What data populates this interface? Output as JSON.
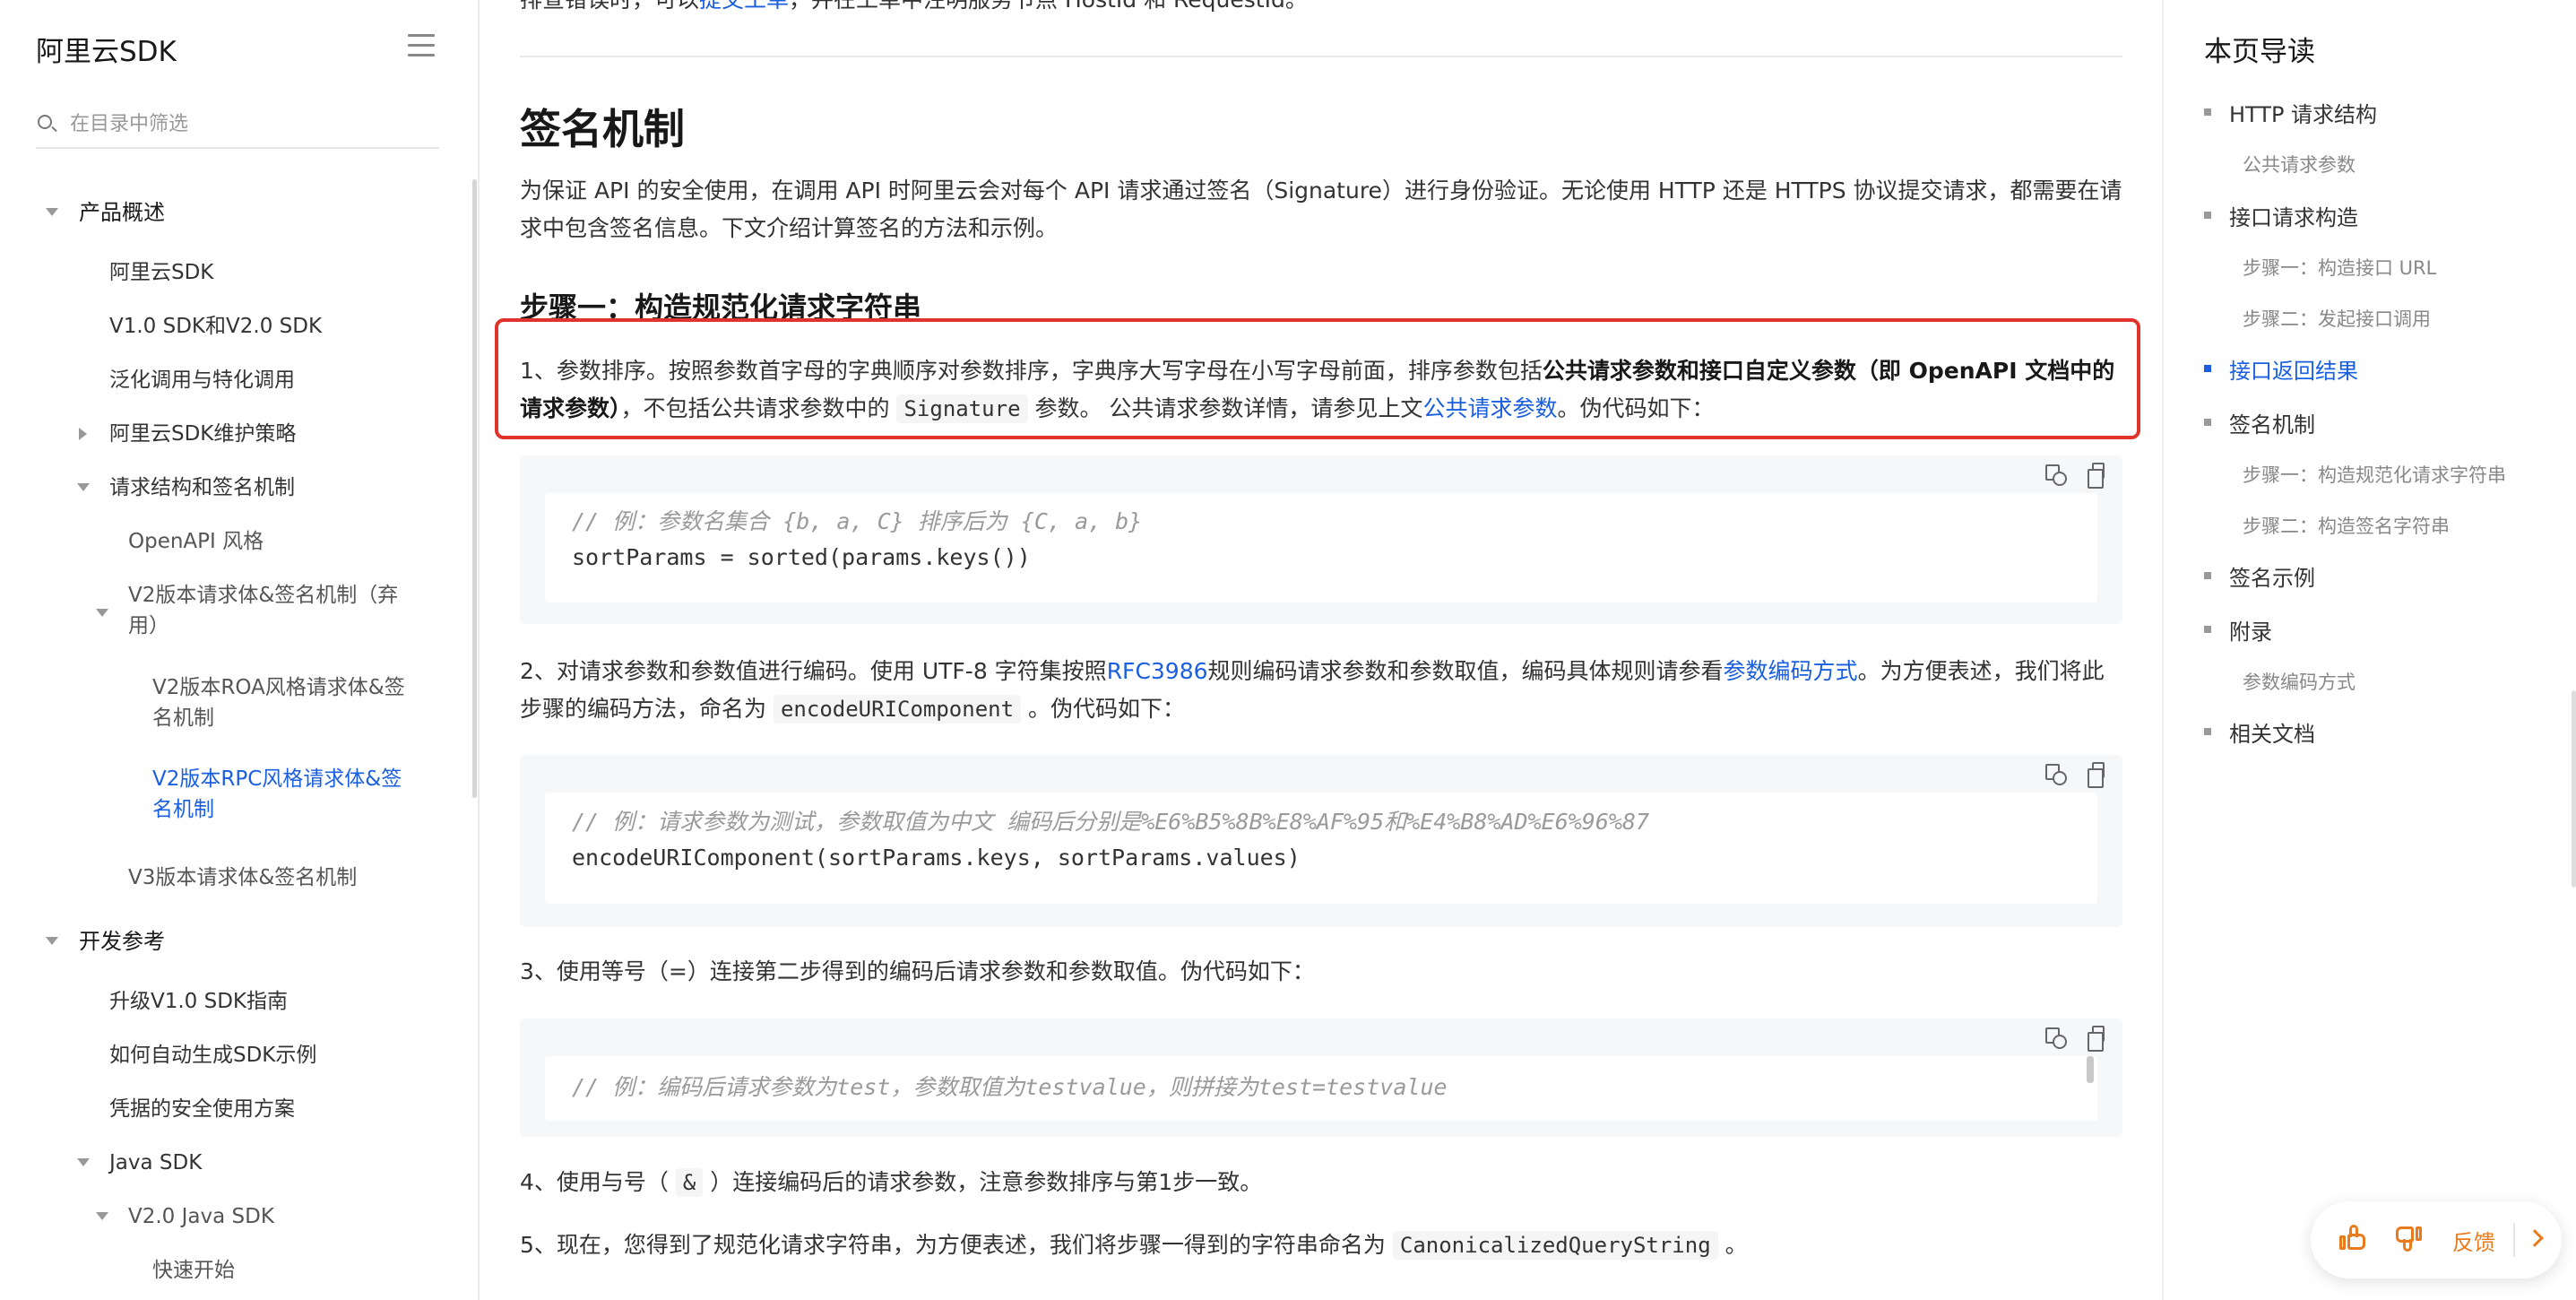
{
  "sidebar": {
    "title": "阿里云SDK",
    "search_placeholder": "在目录中筛选",
    "items": [
      "产品概述",
      "阿里云SDK",
      "V1.0 SDK和V2.0 SDK",
      "泛化调用与特化调用",
      "阿里云SDK维护策略",
      "请求结构和签名机制",
      "OpenAPI 风格",
      "V2版本请求体&签名机制（弃用）",
      "V2版本ROA风格请求体&签名机制",
      "V2版本RPC风格请求体&签名机制",
      "V3版本请求体&签名机制",
      "开发参考",
      "升级V1.0 SDK指南",
      "如何自动生成SDK示例",
      "凭据的安全使用方案",
      "Java SDK",
      "V2.0 Java SDK",
      "快速开始"
    ]
  },
  "main": {
    "top_text_a": "排查错误时，可以",
    "top_text_link": "提交工单",
    "top_text_b": "，并在工单中注明服务节点 HostId 和 RequestId。",
    "section_title": "签名机制",
    "intro": "为保证 API 的安全使用，在调用 API 时阿里云会对每个 API 请求通过签名（Signature）进行身份验证。无论使用 HTTP 还是 HTTPS 协议提交请求，都需要在请求中包含签名信息。下文介绍计算签名的方法和示例。",
    "step1_title": "步骤一：构造规范化请求字符串",
    "p1": {
      "a": "1、参数排序。按照参数首字母的字典顺序对参数排序，字典序大写字母在小写字母前面，排序参数包括",
      "bold": "公共请求参数和接口自定义参数（即 OpenAPI 文档中的请求参数）",
      "b": "，不包括公共请求参数中的",
      "code": "Signature",
      "c": "参数。 公共请求参数详情，请参见上文",
      "link": "公共请求参数",
      "d": "。伪代码如下："
    },
    "code1": {
      "comment": "// 例：参数名集合 {b, a, C} 排序后为 {C, a, b}",
      "line": "sortParams = sorted(params.keys())"
    },
    "p2": {
      "a": "2、对请求参数和参数值进行编码。使用 UTF-8 字符集按照",
      "link1": "RFC3986",
      "b": "规则编码请求参数和参数取值，编码具体规则请参看",
      "link2": "参数编码方式",
      "c": "。为方便表述，我们将此步骤的编码方法，命名为",
      "code": "encodeURIComponent",
      "d": "。伪代码如下："
    },
    "code2": {
      "comment": "// 例：请求参数为测试，参数取值为中文 编码后分别是%E6%B5%8B%E8%AF%95和%E4%B8%AD%E6%96%87",
      "line": "encodeURIComponent(sortParams.keys, sortParams.values)"
    },
    "p3": "3、使用等号（=）连接第二步得到的编码后请求参数和参数取值。伪代码如下：",
    "code3": {
      "comment": "// 例：编码后请求参数为test，参数取值为testvalue，则拼接为test=testvalue"
    },
    "p4": {
      "a": "4、使用与号（",
      "code": "&",
      "b": "）连接编码后的请求参数，注意参数排序与第1步一致。"
    },
    "p5": {
      "a": "5、现在，您得到了规范化请求字符串，为方便表述，我们将步骤一得到的字符串命名为",
      "code": "CanonicalizedQueryString",
      "b": "。"
    }
  },
  "toc": {
    "title": "本页导读",
    "items": [
      "HTTP 请求结构",
      "公共请求参数",
      "接口请求构造",
      "步骤一：构造接口 URL",
      "步骤二：发起接口调用",
      "接口返回结果",
      "签名机制",
      "步骤一：构造规范化请求字符串",
      "步骤二：构造签名字符串",
      "签名示例",
      "附录",
      "参数编码方式",
      "相关文档"
    ]
  },
  "feedback": {
    "label": "反馈"
  },
  "colors": {
    "link": "#1a5fe0",
    "highlight_border": "#e2322c",
    "feedback_accent": "#e87b1e"
  }
}
